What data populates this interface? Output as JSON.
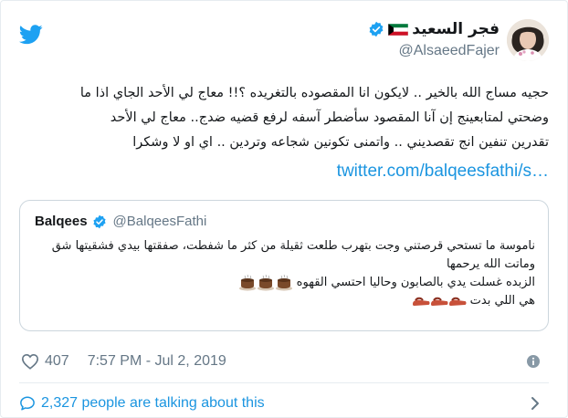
{
  "author": {
    "display_name": "فجر السعيد",
    "handle": "@AlsaeedFajer"
  },
  "tweet": {
    "lines": [
      "حجيه مساج الله بالخير .. لايكون انا المقصوده بالتغريده ؟!! معاج لي الأحد الجاي اذا ما",
      "وضحتي لمتابعينج إن آنا المقصود سأضطر آسفه لرفع قضيه ضدج.. معاج لي الأحد",
      "تقدرين تنفين انج تقصديني .. واتمنى تكونين شجاعه وتردين .. اي او لا وشكرا"
    ],
    "link": "twitter.com/balqeesfathi/s…"
  },
  "quote": {
    "name": "Balqees",
    "handle": "@BalqeesFathi",
    "lines": [
      "ناموسة ما تستحي قرصتني وجت بتهرب طلعت ثقيلة من كثر ما شفطت، صفقتها بيدي فشقيتها شق",
      "وماتت الله يرحمها",
      "الزبده غسلت يدي بالصابون وحاليا احتسي القهوه",
      "هي اللي بدت"
    ]
  },
  "meta": {
    "likes": "407",
    "timestamp": "7:57 PM - Jul 2, 2019"
  },
  "footer": {
    "talking_text": "2,327 people are talking about this"
  },
  "colors": {
    "twitter_blue": "#1da1f2",
    "link_blue": "#1b95e0",
    "muted_gray": "#657786",
    "border": "#ccd6dd"
  },
  "icons": {
    "logo": "twitter-bird-icon",
    "flag": "kuwait-flag-icon",
    "verified": "verified-badge-icon",
    "like": "heart-icon",
    "info": "info-icon",
    "reply": "speech-bubble-icon",
    "more": "chevron-right-icon",
    "coffee": "coffee-cup-emoji",
    "slipper": "slipper-emoji"
  }
}
